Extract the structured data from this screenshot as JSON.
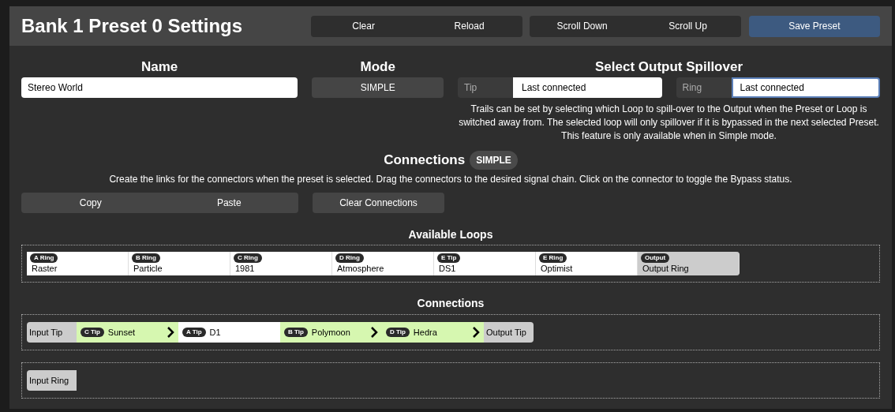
{
  "header": {
    "title": "Bank 1 Preset 0 Settings",
    "button_groups": [
      [
        "Clear",
        "Reload"
      ],
      [
        "Scroll Down",
        "Scroll Up"
      ]
    ],
    "save_button": "Save Preset"
  },
  "name_section": {
    "heading": "Name",
    "value": "Stereo World"
  },
  "mode_section": {
    "heading": "Mode",
    "value": "SIMPLE"
  },
  "spillover": {
    "heading": "Select Output Spillover",
    "selects": [
      {
        "label": "Tip",
        "value": "Last connected",
        "focused": false
      },
      {
        "label": "Ring",
        "value": "Last connected",
        "focused": true
      }
    ],
    "note": "Trails can be set by selecting which Loop to spill-over to the Output when the Preset or Loop is switched away from. The selected loop will only spillover if it is bypassed in the next selected Preset. This feature is only available when in Simple mode."
  },
  "connections_section": {
    "heading": "Connections",
    "badge": "SIMPLE",
    "description": "Create the links for the connectors when the preset is selected. Drag the connectors to the desired signal chain. Click on the connector to toggle the Bypass status.",
    "copy_paste": [
      "Copy",
      "Paste"
    ],
    "clear_button": "Clear Connections"
  },
  "available_loops": {
    "heading": "Available Loops",
    "items": [
      {
        "kind": "loop",
        "badge": "A Ring",
        "name": "Raster"
      },
      {
        "kind": "loop",
        "badge": "B Ring",
        "name": "Particle"
      },
      {
        "kind": "loop",
        "badge": "C Ring",
        "name": "1981"
      },
      {
        "kind": "loop",
        "badge": "D Ring",
        "name": "Atmosphere"
      },
      {
        "kind": "loop",
        "badge": "E Tip",
        "name": "DS1"
      },
      {
        "kind": "loop",
        "badge": "E Ring",
        "name": "Optimist"
      },
      {
        "kind": "output",
        "badge": "Output",
        "name": "Output Ring"
      }
    ]
  },
  "connections": {
    "heading": "Connections",
    "chains": [
      [
        {
          "kind": "endpoint",
          "name": "Input Tip"
        },
        {
          "kind": "loop",
          "badge": "C Tip",
          "name": "Sunset",
          "active": true
        },
        {
          "kind": "loop",
          "badge": "A Tip",
          "name": "D1",
          "active": false
        },
        {
          "kind": "loop",
          "badge": "B Tip",
          "name": "Polymoon",
          "active": true
        },
        {
          "kind": "loop",
          "badge": "D Tip",
          "name": "Hedra",
          "active": true
        },
        {
          "kind": "endpoint",
          "name": "Output Tip"
        }
      ],
      [
        {
          "kind": "endpoint",
          "name": "Input Ring"
        }
      ]
    ]
  }
}
